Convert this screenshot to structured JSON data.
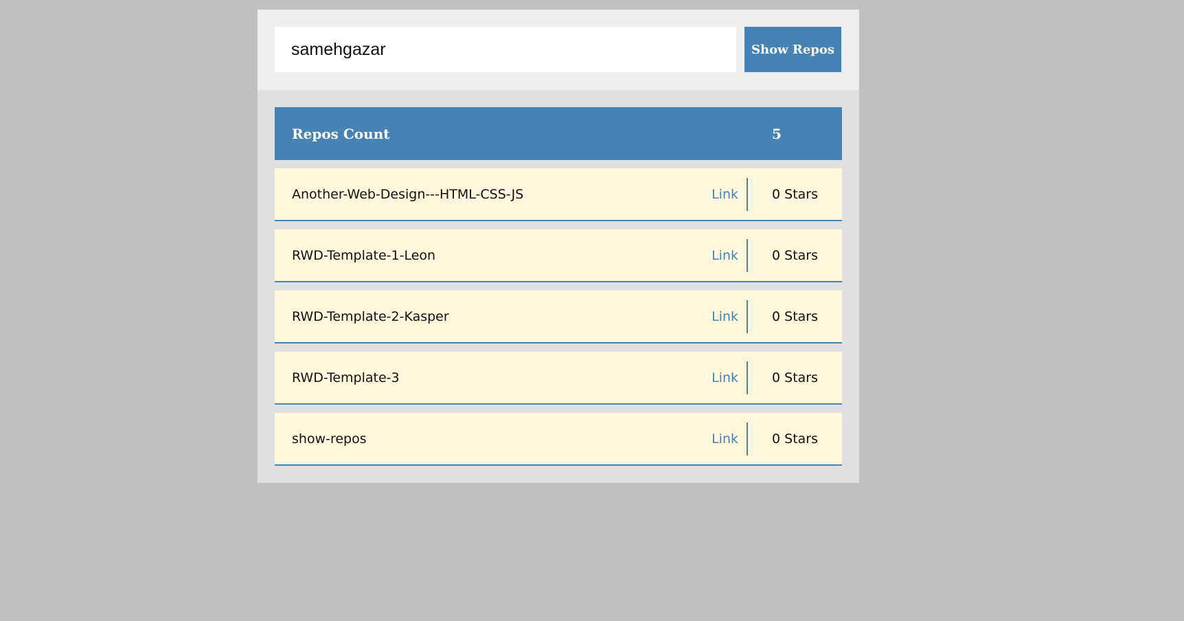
{
  "search": {
    "value": "samehgazar",
    "button_label": "Show Repos"
  },
  "summary": {
    "label": "Repos Count",
    "count": "5"
  },
  "repos": [
    {
      "name": "Another-Web-Design---HTML-CSS-JS",
      "link_label": "Link",
      "stars": "0 Stars"
    },
    {
      "name": "RWD-Template-1-Leon",
      "link_label": "Link",
      "stars": "0 Stars"
    },
    {
      "name": "RWD-Template-2-Kasper",
      "link_label": "Link",
      "stars": "0 Stars"
    },
    {
      "name": "RWD-Template-3",
      "link_label": "Link",
      "stars": "0 Stars"
    },
    {
      "name": "show-repos",
      "link_label": "Link",
      "stars": "0 Stars"
    }
  ],
  "colors": {
    "page_background": "#c0c0c0",
    "accent": "#4682b4",
    "row_background": "#fff8dc",
    "search_panel": "#eeeeee",
    "results_panel": "#e0e0e0"
  }
}
